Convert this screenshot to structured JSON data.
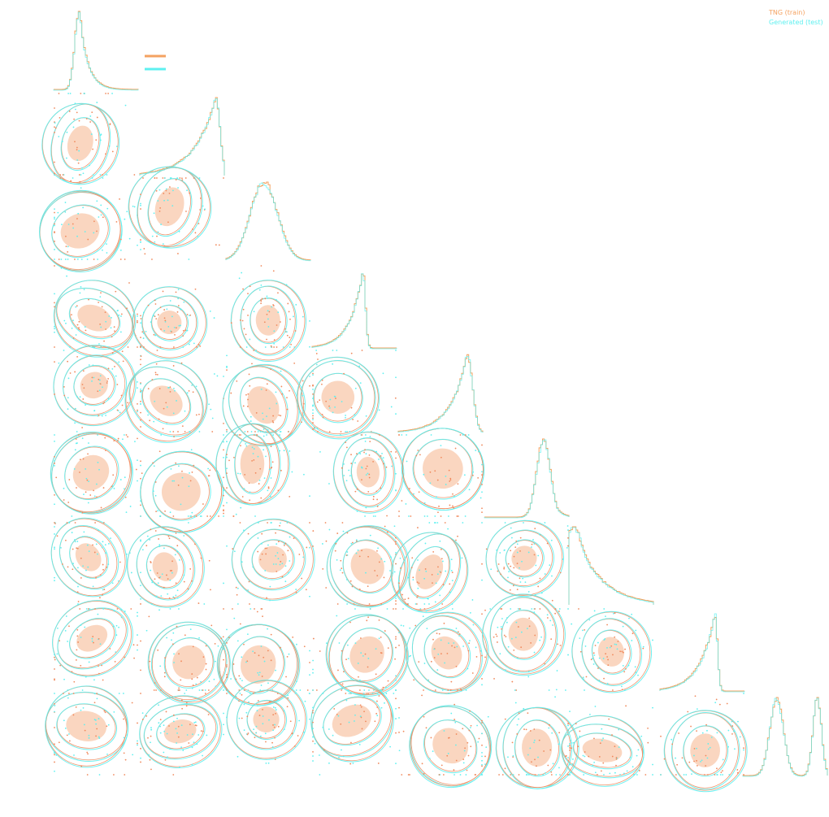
{
  "chart_data": {
    "type": "scatter",
    "plot_kind": "corner (pairwise 2D density contours with marginal 1D histograms)",
    "n_parameters": 9,
    "axes_labels_shown": false,
    "grid": false,
    "legend_placement": "top-right",
    "legend": [
      {
        "label": "TNG (train)",
        "color": "#f4a261"
      },
      {
        "label": "Generated (test)",
        "color": "#5ef0f0"
      }
    ],
    "colors": {
      "train": "#f4a261",
      "train_outline": "#f08a5d",
      "generated": "#5ef0f0",
      "density_fill": "#f6b48c"
    }
  }
}
